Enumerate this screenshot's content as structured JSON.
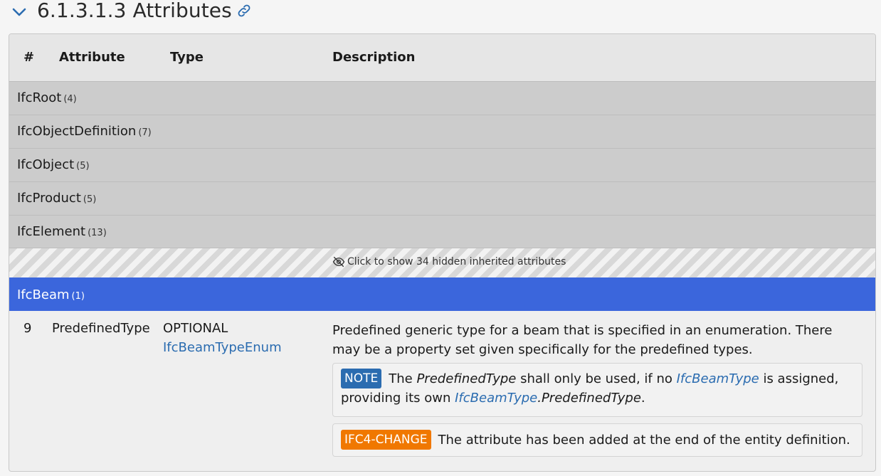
{
  "section": {
    "number_title": "6.1.3.1.3 Attributes",
    "collapse_icon": "chevron-down-icon",
    "permalink_icon": "link-icon"
  },
  "columns": [
    "#",
    "Attribute",
    "Type",
    "Description"
  ],
  "inherited_groups": [
    {
      "name": "IfcRoot",
      "count": "(4)"
    },
    {
      "name": "IfcObjectDefinition",
      "count": "(7)"
    },
    {
      "name": "IfcObject",
      "count": "(5)"
    },
    {
      "name": "IfcProduct",
      "count": "(5)"
    },
    {
      "name": "IfcElement",
      "count": "(13)"
    }
  ],
  "hidden_notice": "Click to show 34 hidden inherited attributes",
  "current_group": {
    "name": "IfcBeam",
    "count": "(1)"
  },
  "rows": [
    {
      "index": "9",
      "attribute": "PredefinedType",
      "type_qualifier": "OPTIONAL",
      "type_link": "IfcBeamTypeEnum",
      "description": "Predefined generic type for a beam that is specified in an enumeration. There may be a property set given specifically for the predefined types.",
      "note": {
        "badge": "NOTE",
        "t1": "The ",
        "i1": "PredefinedType",
        "t2": " shall only be used, if no ",
        "l1": "IfcBeamType",
        "t3": " is assigned, providing its own ",
        "l2": "IfcBeamType",
        "i2": ".PredefinedType",
        "t4": "."
      },
      "change": {
        "badge": "IFC4-CHANGE",
        "text": "The attribute has been added at the end of the entity definition."
      }
    }
  ],
  "colors": {
    "accent": "#3b66dc",
    "link": "#2b6cb0",
    "note_badge": "#2b6cb0",
    "change_badge": "#f07800",
    "group_bg": "#cccccc"
  }
}
